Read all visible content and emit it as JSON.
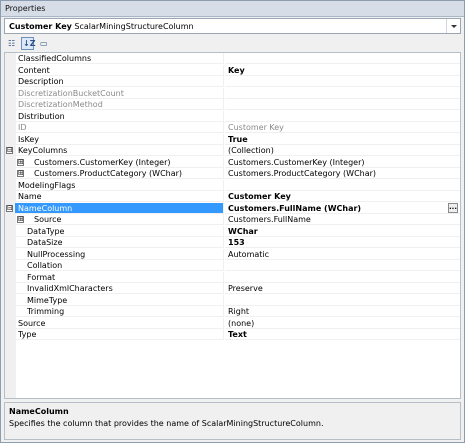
{
  "window": {
    "title": "Properties"
  },
  "object_selector": {
    "bold": "Customer Key",
    "type": "ScalarMiningStructureColumn"
  },
  "toolbar": {
    "categorized_icon": "categorized-icon",
    "alphabetical_icon": "alphabetical-icon",
    "pages_icon": "property-pages-icon"
  },
  "rows": [
    {
      "name": "ClassifiedColumns",
      "value": ""
    },
    {
      "name": "Content",
      "value": "Key",
      "bold": true
    },
    {
      "name": "Description",
      "value": ""
    },
    {
      "name": "DiscretizationBucketCount",
      "value": "",
      "disabled": true
    },
    {
      "name": "DiscretizationMethod",
      "value": "",
      "disabled": true
    },
    {
      "name": "Distribution",
      "value": ""
    },
    {
      "name": "ID",
      "value": "Customer Key",
      "disabled": true
    },
    {
      "name": "IsKey",
      "value": "True",
      "bold": true
    },
    {
      "name": "KeyColumns",
      "value": "(Collection)",
      "expander": "⊟"
    },
    {
      "name": "Customers.CustomerKey (Integer)",
      "value": "Customers.CustomerKey (Integer)",
      "expander": "⊞",
      "child": true
    },
    {
      "name": "Customers.ProductCategory (WChar)",
      "value": "Customers.ProductCategory (WChar)",
      "expander": "⊞",
      "child": true
    },
    {
      "name": "ModelingFlags",
      "value": ""
    },
    {
      "name": "Name",
      "value": "Customer Key",
      "bold": true
    },
    {
      "name": "NameColumn",
      "value": "Customers.FullName (WChar)",
      "bold": true,
      "selected": true,
      "expander": "⊟",
      "ellipsis": "..."
    },
    {
      "name": "Source",
      "value": "Customers.FullName",
      "expander": "⊞",
      "child": true
    },
    {
      "name": "DataType",
      "value": "WChar",
      "bold": true,
      "grandchild": true
    },
    {
      "name": "DataSize",
      "value": "153",
      "bold": true,
      "grandchild": true
    },
    {
      "name": "NullProcessing",
      "value": "Automatic",
      "grandchild": true
    },
    {
      "name": "Collation",
      "value": "",
      "grandchild": true
    },
    {
      "name": "Format",
      "value": "",
      "grandchild": true
    },
    {
      "name": "InvalidXmlCharacters",
      "value": "Preserve",
      "grandchild": true
    },
    {
      "name": "MimeType",
      "value": "",
      "grandchild": true
    },
    {
      "name": "Trimming",
      "value": "Right",
      "grandchild": true
    },
    {
      "name": "Source",
      "value": "(none)"
    },
    {
      "name": "Type",
      "value": "Text",
      "bold": true
    }
  ],
  "description": {
    "title": "NameColumn",
    "text": "Specifies the column that provides the name of ScalarMiningStructureColumn."
  },
  "colors": {
    "selection": "#3399ff",
    "gutter": "#f0f0f0"
  }
}
